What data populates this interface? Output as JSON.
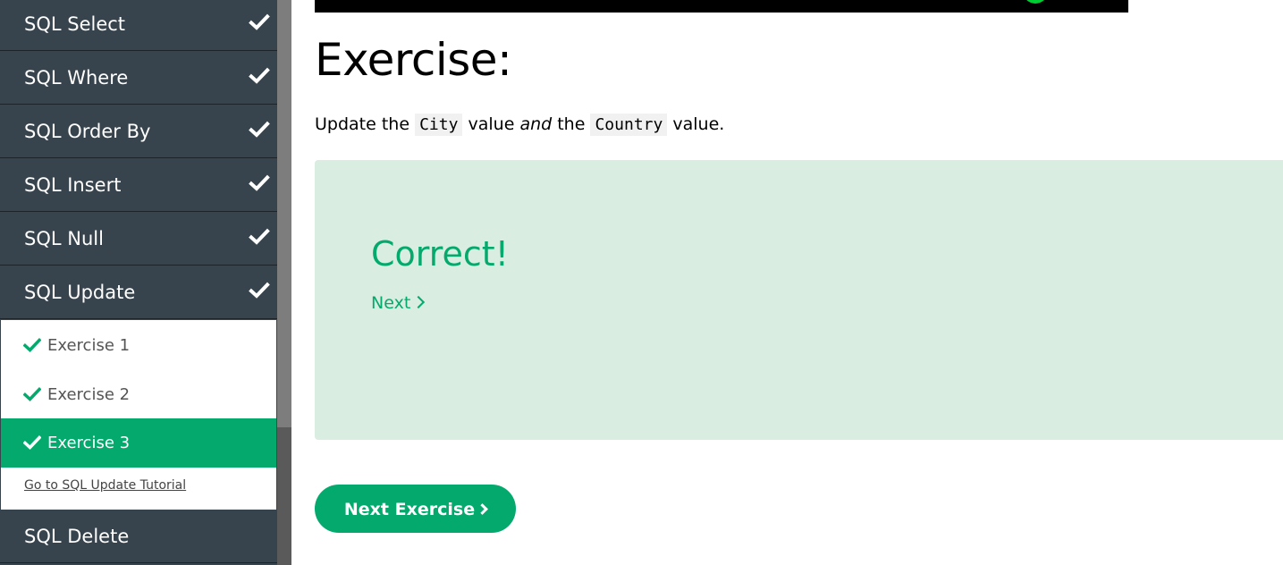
{
  "sidebar": {
    "categories": [
      {
        "label": "SQL Select",
        "icon": "check-icon"
      },
      {
        "label": "SQL Where",
        "icon": "check-icon"
      },
      {
        "label": "SQL Order By",
        "icon": "check-icon"
      },
      {
        "label": "SQL Insert",
        "icon": "check-icon"
      },
      {
        "label": "SQL Null",
        "icon": "check-icon"
      },
      {
        "label": "SQL Update",
        "icon": "check-icon"
      },
      {
        "label": "SQL Delete",
        "icon": null
      }
    ],
    "exercises": [
      {
        "label": "Exercise 1",
        "completed": true,
        "active": false
      },
      {
        "label": "Exercise 2",
        "completed": true,
        "active": false
      },
      {
        "label": "Exercise 3",
        "completed": true,
        "active": true
      }
    ],
    "tutorial_link": "Go to SQL Update Tutorial"
  },
  "main": {
    "heading": "Exercise:",
    "instruction": {
      "part1": "Update the",
      "code1": "City",
      "part2": "value",
      "emph": "and",
      "part3": "the",
      "code2": "Country",
      "part4": "value."
    },
    "result": {
      "message": "Correct!",
      "next_link": "Next"
    },
    "next_exercise_button": "Next Exercise"
  },
  "colors": {
    "sidebar_bg": "#38444d",
    "accent_green": "#04aa6d",
    "result_bg": "#d9ede1"
  }
}
